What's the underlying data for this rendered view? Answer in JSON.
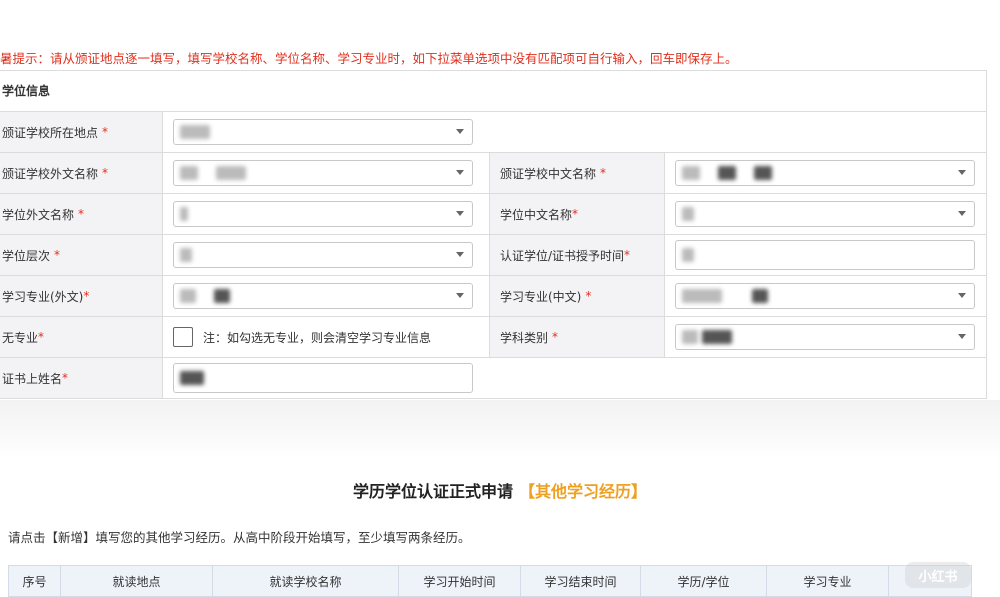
{
  "notice": "暑提示：请从颁证地点逐一填写，填写学校名称、学位名称、学习专业时，如下拉菜单选项中没有匹配项可自行输入，回车即保存上。",
  "form": {
    "header": "学位信息",
    "rows": [
      {
        "label": "颁证学校所在地点",
        "req": "*"
      },
      {
        "label": "颁证学校外文名称",
        "req": "*",
        "label2": "颁证学校中文名称",
        "req2": "*"
      },
      {
        "label": "学位外文名称",
        "req": "*",
        "label2": "学位中文名称",
        "req2": "*"
      },
      {
        "label": "学位层次",
        "req": "*",
        "label2": "认证学位/证书授予时间",
        "req2": "*"
      },
      {
        "label": "学习专业(外文)",
        "req": "*",
        "label2": "学习专业(中文)",
        "req2": "*"
      },
      {
        "label": "无专业",
        "req": "*",
        "note": "注：如勾选无专业，则会清空学习专业信息",
        "label2": "学科类别",
        "req2": "*"
      },
      {
        "label": "证书上姓名",
        "req": "*"
      }
    ]
  },
  "section": {
    "title": "学历学位认证正式申请",
    "subtitle": "【其他学习经历】",
    "instruction": "请点击【新增】填写您的其他学习经历。从高中阶段开始填写，至少填写两条经历。",
    "columns": [
      "序号",
      "就读地点",
      "就读学校名称",
      "学习开始时间",
      "学习结束时间",
      "学历/学位",
      "学习专业"
    ]
  },
  "watermark": "小红书",
  "colors": {
    "required": "#e0301e",
    "accent": "#f0a020",
    "label_bg": "#f3f3f6"
  }
}
